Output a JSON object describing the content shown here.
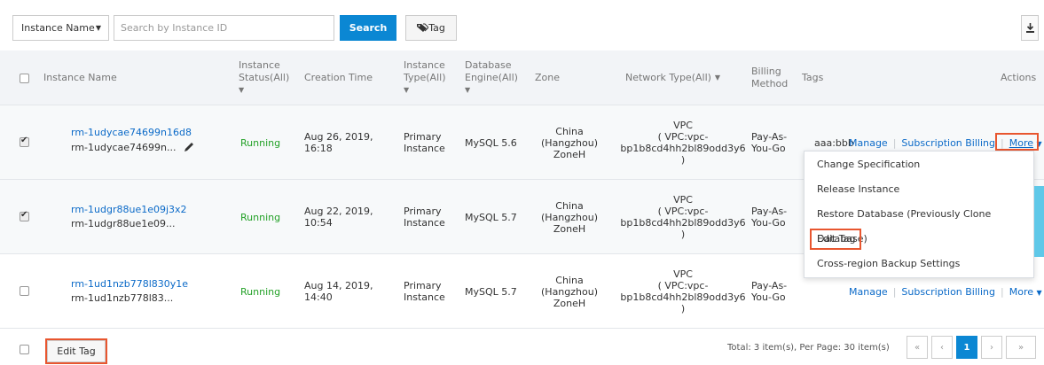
{
  "toolbar": {
    "filter_select": "Instance Name",
    "search_placeholder": "Search by Instance ID",
    "search_label": "Search",
    "tag_label": "Tag"
  },
  "columns": {
    "instance_name": "Instance Name",
    "status_l1": "Instance",
    "status_l2": "Status(All)",
    "creation_time": "Creation Time",
    "type_l1": "Instance",
    "type_l2": "Type(All)",
    "engine_l1": "Database",
    "engine_l2": "Engine(All)",
    "zone": "Zone",
    "network_type": "Network Type(All)",
    "billing_l1": "Billing",
    "billing_l2": "Method",
    "tags": "Tags",
    "actions": "Actions"
  },
  "rows": [
    {
      "id": "rm-1udycae74699n16d8",
      "name": "rm-1udycae74699n...",
      "status": "Running",
      "time_l1": "Aug 26, 2019,",
      "time_l2": "16:18",
      "type_l1": "Primary",
      "type_l2": "Instance",
      "engine": "MySQL 5.6",
      "zone_l1": "China",
      "zone_l2": "(Hangzhou)",
      "zone_l3": "ZoneH",
      "net_l1": "VPC",
      "net_l2": "( VPC:vpc-",
      "net_l3": "bp1b8cd4hh2bl89odd3y6",
      "net_l4": ")",
      "billing_l1": "Pay-As-",
      "billing_l2": "You-Go",
      "tag": "aaa:bbb",
      "manage": "Manage",
      "subscription": "Subscription Billing",
      "more": "More"
    },
    {
      "id": "rm-1udgr88ue1e09j3x2",
      "name": "rm-1udgr88ue1e09...",
      "status": "Running",
      "time_l1": "Aug 22, 2019,",
      "time_l2": "10:54",
      "type_l1": "Primary",
      "type_l2": "Instance",
      "engine": "MySQL 5.7",
      "zone_l1": "China",
      "zone_l2": "(Hangzhou)",
      "zone_l3": "ZoneH",
      "net_l1": "VPC",
      "net_l2": "( VPC:vpc-",
      "net_l3": "bp1b8cd4hh2bl89odd3y6",
      "net_l4": ")",
      "billing_l1": "Pay-As-",
      "billing_l2": "You-Go"
    },
    {
      "id": "rm-1ud1nzb778l830y1e",
      "name": "rm-1ud1nzb778l83...",
      "status": "Running",
      "time_l1": "Aug 14, 2019,",
      "time_l2": "14:40",
      "type_l1": "Primary",
      "type_l2": "Instance",
      "engine": "MySQL 5.7",
      "zone_l1": "China",
      "zone_l2": "(Hangzhou)",
      "zone_l3": "ZoneH",
      "net_l1": "VPC",
      "net_l2": "( VPC:vpc-",
      "net_l3": "bp1b8cd4hh2bl89odd3y6",
      "net_l4": ")",
      "billing_l1": "Pay-As-",
      "billing_l2": "You-Go",
      "manage": "Manage",
      "subscription": "Subscription Billing",
      "more": "More"
    }
  ],
  "more_menu": [
    "Change Specification",
    "Release Instance",
    "Restore Database (Previously Clone Database)",
    "Edit Tag",
    "Cross-region Backup Settings"
  ],
  "footer": {
    "edit_tag": "Edit Tag",
    "total": "Total: 3 item(s), Per Page: 30 item(s)",
    "first": "«",
    "prev": "‹",
    "page": "1",
    "next": "›",
    "last": "»"
  },
  "colors": {
    "primary": "#0b87d3",
    "link": "#0b6ac8",
    "running": "#23a127",
    "highlight": "#e8562f"
  }
}
